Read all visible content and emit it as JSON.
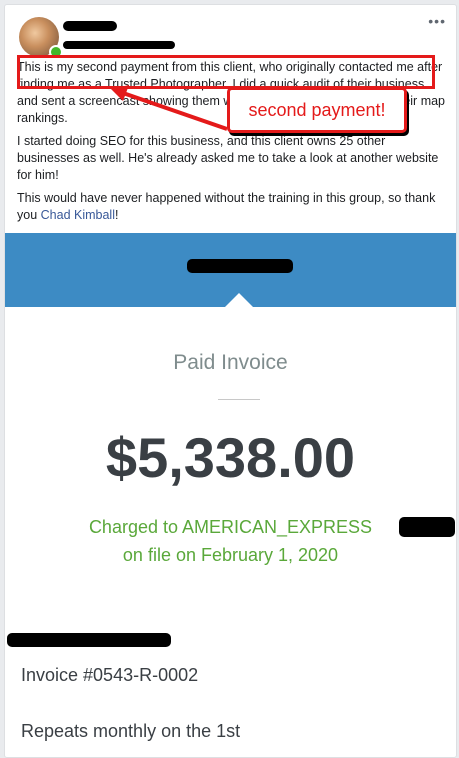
{
  "post": {
    "paragraph1": "This is my second payment from this client, who originally contacted me after finding me as a Trusted Photographer. I did a quick audit of their business and sent a screencast showing them what they could do to improve their map rankings.",
    "paragraph2": "I started doing SEO for this business, and this client owns 25 other businesses as well. He's already asked me to take a look at another website for him!",
    "paragraph3_before": "This would have never happened without the training in this group, so thank you ",
    "tagged_name": "Chad Kimball",
    "paragraph3_after": "!",
    "more_label": "•••"
  },
  "annotation": {
    "callout_text": "second payment!",
    "color": "#e41a1a"
  },
  "invoice": {
    "banner_color": "#3d8bc4",
    "status": "Paid Invoice",
    "amount": "$5,338.00",
    "charged_line1": "Charged to AMERICAN_EXPRESS",
    "charged_line2": "on file on February 1, 2020",
    "invoice_number": "Invoice #0543-R-0002",
    "repeats": "Repeats monthly on the 1st"
  }
}
